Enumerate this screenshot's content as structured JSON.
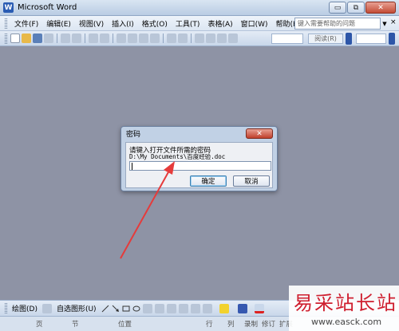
{
  "app": {
    "title": "Microsoft Word",
    "icon": "word-app-icon",
    "icon_letter": "W"
  },
  "window_controls": {
    "minimize": "▭",
    "restore": "⧉",
    "close": "✕"
  },
  "menu": {
    "items": [
      "文件(F)",
      "编辑(E)",
      "视图(V)",
      "插入(I)",
      "格式(O)",
      "工具(T)",
      "表格(A)",
      "窗口(W)",
      "帮助(H)"
    ],
    "help_placeholder": "键入需要帮助的问题",
    "close_doc": "×"
  },
  "toolbar": {
    "reading_label": "阅读(R)"
  },
  "dialog": {
    "title": "密码",
    "prompt": "请键入打开文件所需的密码",
    "file_path": "D:\\My Documents\\百度经验.doc",
    "password_value": "",
    "ok_label": "确定",
    "cancel_label": "取消",
    "close_glyph": "✕"
  },
  "drawing_toolbar": {
    "draw_label": "绘图(D)",
    "autoshapes_label": "自选图形(U)"
  },
  "status_bar": {
    "page": "页",
    "section": "节",
    "position": "位置",
    "line": "行",
    "column": "列",
    "record": "录制",
    "revision": "修订",
    "extend": "扩展"
  },
  "watermark": {
    "text": "易采站长站",
    "url": "www.easck.com"
  },
  "colors": {
    "workspace": "#8e93a5",
    "watermark_red": "#cf1f2f",
    "arrow": "#e53b3b"
  }
}
